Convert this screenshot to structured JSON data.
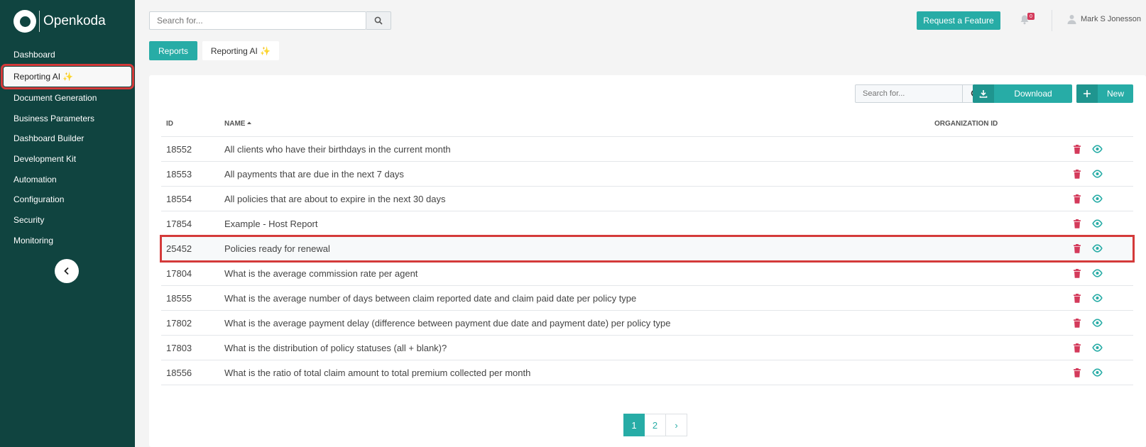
{
  "app": {
    "name": "Openkoda"
  },
  "sidebar": {
    "items": [
      {
        "label": "Dashboard"
      },
      {
        "label": "Reporting AI ✨"
      },
      {
        "label": "Document Generation"
      },
      {
        "label": "Business Parameters"
      },
      {
        "label": "Dashboard Builder"
      },
      {
        "label": "Development Kit"
      },
      {
        "label": "Automation"
      },
      {
        "label": "Configuration"
      },
      {
        "label": "Security"
      },
      {
        "label": "Monitoring"
      }
    ],
    "collapse_icon": "chevron-left-icon"
  },
  "header": {
    "search_placeholder": "Search for...",
    "feature_button": "Request a Feature",
    "notifications_count": "0",
    "user_name": "Mark S Jonesson"
  },
  "tabs": [
    {
      "label": "Reports"
    },
    {
      "label": "Reporting AI ✨"
    }
  ],
  "table": {
    "search_placeholder": "Search for...",
    "download_label": "Download",
    "new_label": "New",
    "columns": {
      "id": "ID",
      "name": "NAME",
      "org": "ORGANIZATION ID"
    },
    "rows": [
      {
        "id": "18552",
        "name": "All clients who have their birthdays in the current month"
      },
      {
        "id": "18553",
        "name": "All payments that are due in the next 7 days"
      },
      {
        "id": "18554",
        "name": "All policies that are about to expire in the next 30 days"
      },
      {
        "id": "17854",
        "name": "Example - Host Report"
      },
      {
        "id": "25452",
        "name": "Policies ready for renewal"
      },
      {
        "id": "17804",
        "name": "What is the average commission rate per agent"
      },
      {
        "id": "18555",
        "name": "What is the average number of days between claim reported date and claim paid date per policy type"
      },
      {
        "id": "17802",
        "name": "What is the average payment delay (difference between payment due date and payment date) per policy type"
      },
      {
        "id": "17803",
        "name": "What is the distribution of policy statuses (all + blank)?"
      },
      {
        "id": "18556",
        "name": "What is the ratio of total claim amount to total premium collected per month"
      }
    ]
  },
  "pagination": {
    "pages": [
      "1",
      "2"
    ],
    "current": "1",
    "next": "›"
  },
  "colors": {
    "sidebar": "#104440",
    "accent": "#27aca6",
    "delete": "#d43a5b",
    "highlight": "#d43a3a"
  }
}
